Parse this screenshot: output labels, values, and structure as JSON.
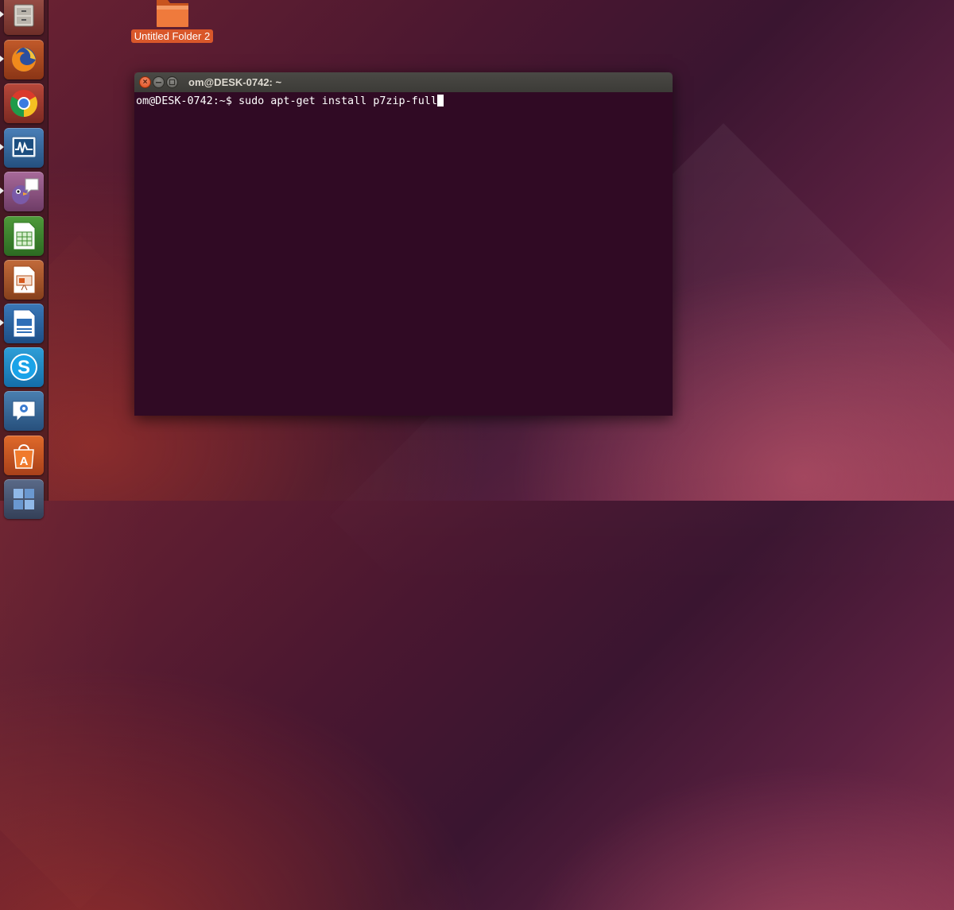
{
  "desktop": {
    "folder_label": "Untitled Folder 2"
  },
  "launcher": {
    "items": [
      {
        "name": "files",
        "icon": "file-cabinet-icon",
        "running": true
      },
      {
        "name": "firefox",
        "icon": "firefox-icon",
        "running": true
      },
      {
        "name": "chromium",
        "icon": "chromium-icon",
        "running": false
      },
      {
        "name": "system-monitor",
        "icon": "system-monitor-icon",
        "running": true
      },
      {
        "name": "pidgin",
        "icon": "pidgin-icon",
        "running": true
      },
      {
        "name": "libreoffice-calc",
        "icon": "spreadsheet-icon",
        "running": false
      },
      {
        "name": "libreoffice-impress",
        "icon": "presentation-icon",
        "running": false
      },
      {
        "name": "libreoffice-writer",
        "icon": "document-icon",
        "running": true
      },
      {
        "name": "skype",
        "icon": "skype-icon",
        "running": false
      },
      {
        "name": "empathy",
        "icon": "chat-icon",
        "running": false
      },
      {
        "name": "software-center",
        "icon": "shopping-bag-icon",
        "running": false
      },
      {
        "name": "workspaces",
        "icon": "workspace-switcher-icon",
        "running": false
      }
    ]
  },
  "terminal": {
    "title": "om@DESK-0742: ~",
    "prompt": "om@DESK-0742:~$ ",
    "command": "sudo apt-get install p7zip-full",
    "close_glyph": "×",
    "colors": {
      "background": "#300a24",
      "text": "#ffffff",
      "titlebar": "#3c3b37",
      "close": "#df4a17"
    }
  },
  "colors": {
    "folder_label_bg": "#d9572a"
  }
}
